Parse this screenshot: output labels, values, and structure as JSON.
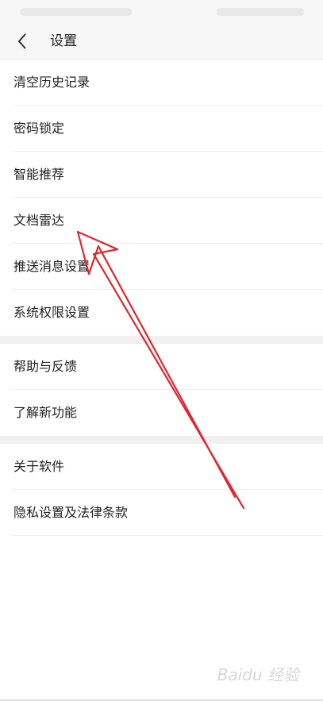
{
  "header": {
    "title": "设置"
  },
  "groups": [
    {
      "items": [
        {
          "label": "清空历史记录"
        },
        {
          "label": "密码锁定"
        },
        {
          "label": "智能推荐"
        },
        {
          "label": "文档雷达"
        },
        {
          "label": "推送消息设置"
        },
        {
          "label": "系统权限设置"
        }
      ]
    },
    {
      "items": [
        {
          "label": "帮助与反馈"
        },
        {
          "label": "了解新功能"
        }
      ]
    },
    {
      "items": [
        {
          "label": "关于软件"
        },
        {
          "label": "隐私设置及法律条款"
        }
      ]
    }
  ],
  "colors": {
    "annotation_arrow": "#e0262f",
    "section_gap": "#f0f0f0",
    "header_bg": "#f7f7f7"
  },
  "icons": {
    "back": "chevron-left-icon"
  },
  "watermark": "Baidu 经验"
}
